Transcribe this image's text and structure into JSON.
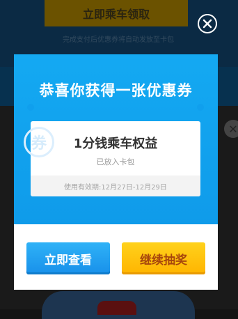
{
  "background": {
    "top_button_label": "立即乘车领取",
    "top_subtext": "完成支付后优惠券将自动发放至卡包"
  },
  "modal": {
    "title": "恭喜你获得一张优惠券",
    "coupon": {
      "watermark": "券",
      "name": "1分钱乘车权益",
      "status": "已放入卡包",
      "validity": "使用有效期:12月27日-12月29日"
    },
    "buttons": {
      "view_label": "立即查看",
      "continue_label": "继续抽奖"
    }
  },
  "colors": {
    "header_blue": "#14a9f2",
    "view_button": "#1f9cf0",
    "continue_button": "#ffc20e",
    "continue_text": "#a7460d"
  },
  "icons": {
    "close": "close-icon"
  }
}
